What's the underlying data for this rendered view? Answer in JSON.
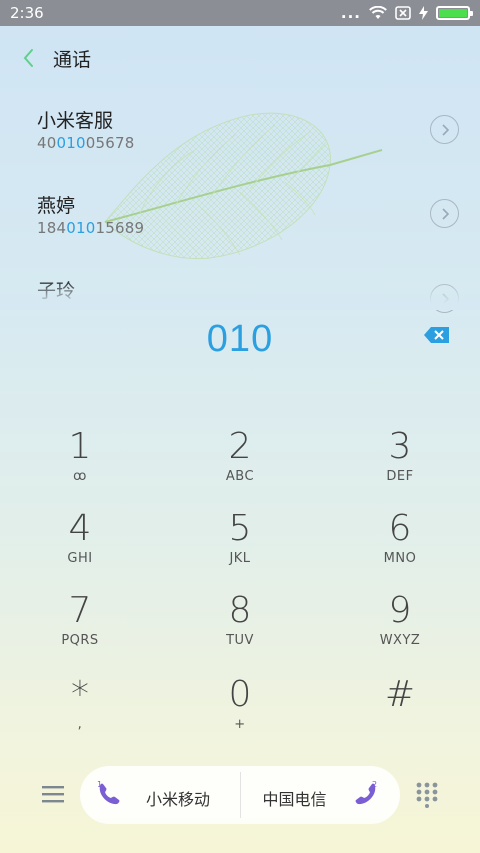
{
  "status": {
    "time": "2:36",
    "dots": "..."
  },
  "header": {
    "title": "通话"
  },
  "contacts": [
    {
      "name": "小米客服",
      "num_pre": "40",
      "num_hl": "010",
      "num_post": "05678"
    },
    {
      "name": "燕婷",
      "num_pre": "184",
      "num_hl": "010",
      "num_post": "15689"
    },
    {
      "name": "子玲"
    }
  ],
  "dial": {
    "entered": "010"
  },
  "keys": [
    {
      "digit": "1",
      "sub": "ꝏ"
    },
    {
      "digit": "2",
      "sub": "ABC"
    },
    {
      "digit": "3",
      "sub": "DEF"
    },
    {
      "digit": "4",
      "sub": "GHI"
    },
    {
      "digit": "5",
      "sub": "JKL"
    },
    {
      "digit": "6",
      "sub": "MNO"
    },
    {
      "digit": "7",
      "sub": "PQRS"
    },
    {
      "digit": "8",
      "sub": "TUV"
    },
    {
      "digit": "9",
      "sub": "WXYZ"
    },
    {
      "digit": "*",
      "sub": ","
    },
    {
      "digit": "0",
      "sub": "+"
    },
    {
      "digit": "#",
      "sub": ""
    }
  ],
  "sims": [
    {
      "label": "小米移动",
      "badge": "1"
    },
    {
      "label": "中国电信",
      "badge": "2"
    }
  ],
  "colors": {
    "accent": "#2b9fe0",
    "back_arrow": "#5fd08a",
    "call": "#7a5fd4"
  }
}
